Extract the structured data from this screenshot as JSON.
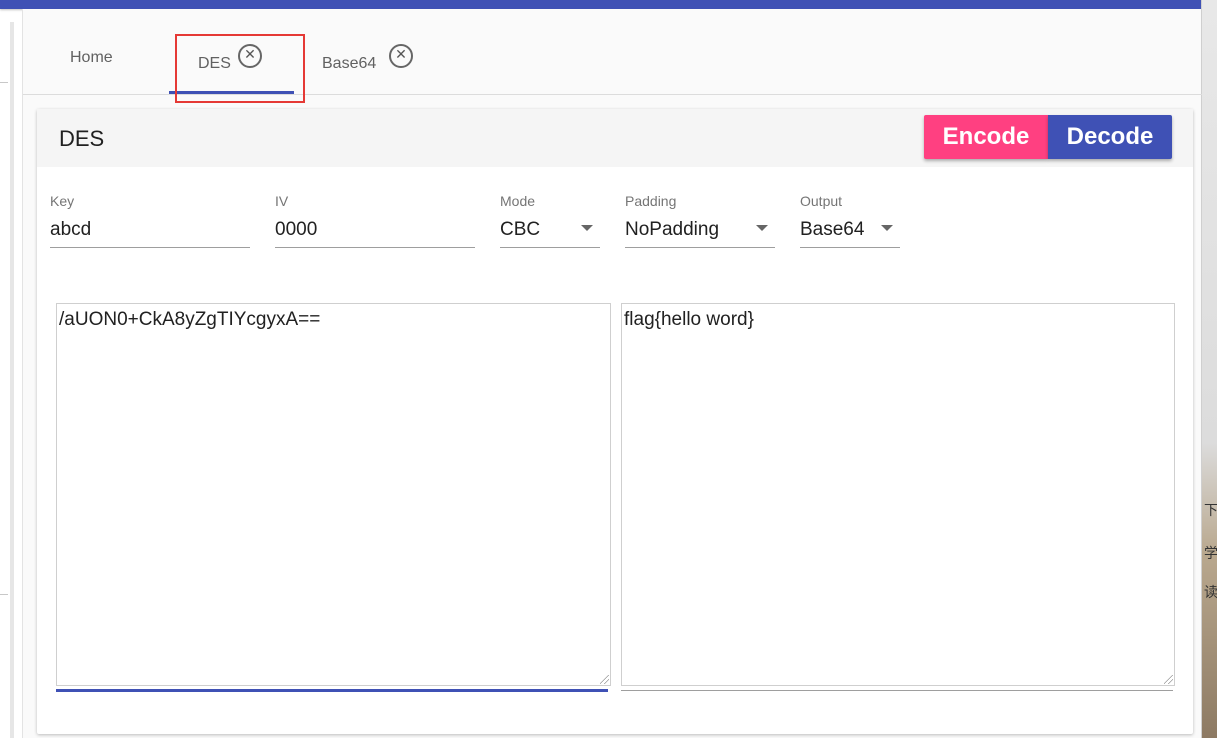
{
  "tabs": [
    {
      "label": "Home"
    },
    {
      "label": "DES",
      "active": true
    },
    {
      "label": "Base64"
    }
  ],
  "icons": {
    "tab_close": "close-circle-icon",
    "dropdown": "caret-down-icon"
  },
  "close_glyph": "✕",
  "card": {
    "title": "DES",
    "encode_label": "Encode",
    "decode_label": "Decode"
  },
  "fields": {
    "key": {
      "label": "Key",
      "value": "abcd"
    },
    "iv": {
      "label": "IV",
      "value": "0000"
    },
    "mode": {
      "label": "Mode",
      "value": "CBC"
    },
    "padding": {
      "label": "Padding",
      "value": "NoPadding"
    },
    "output": {
      "label": "Output",
      "value": "Base64"
    }
  },
  "input_text": "/aUON0+CkA8yZgTIYcgyxA==",
  "output_text": "flag{hello word}",
  "side_glyphs": [
    "下",
    "学",
    "读"
  ],
  "colors": {
    "primary": "#3f51b5",
    "accent": "#ff4081",
    "highlight": "#e53935"
  }
}
